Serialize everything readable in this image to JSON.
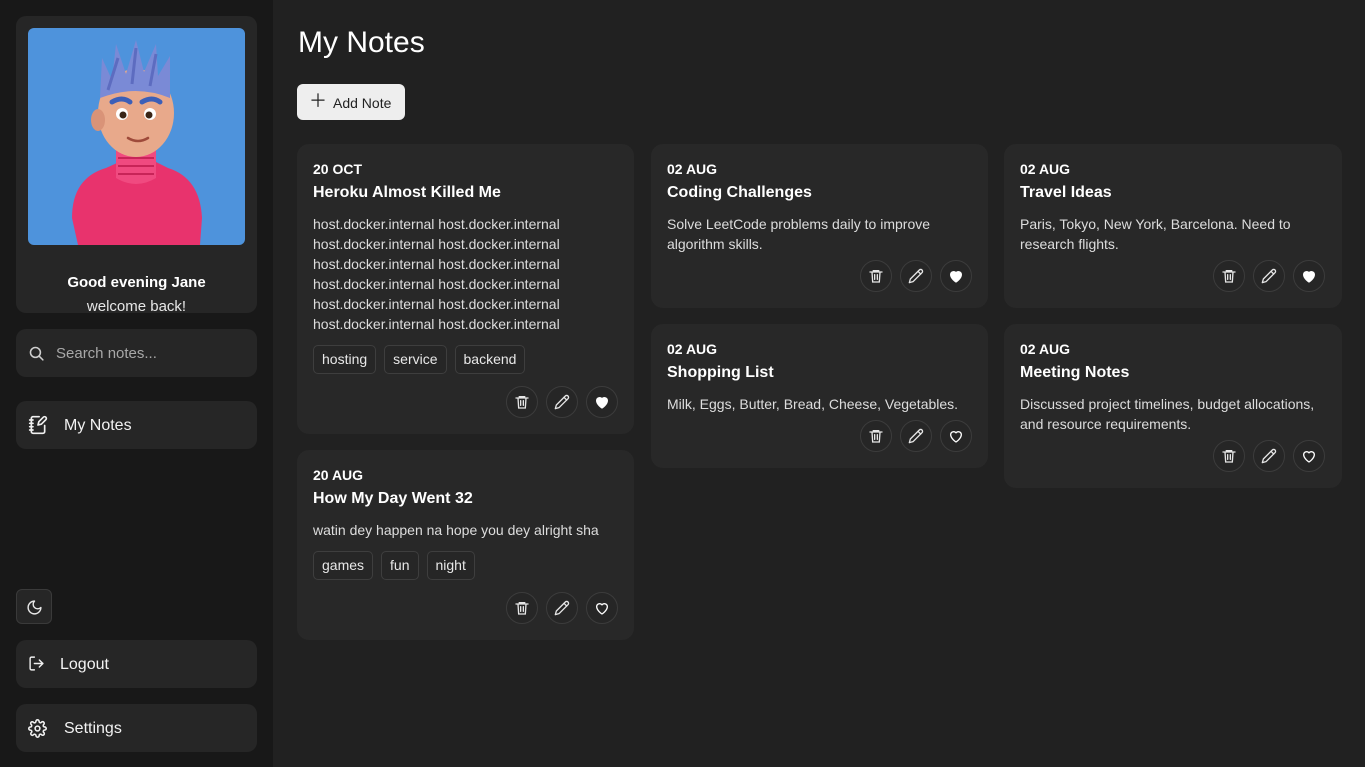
{
  "profile": {
    "greeting": "Good evening Jane",
    "welcome": "welcome back!",
    "avatar_bg": "#4e93dc"
  },
  "search": {
    "placeholder": "Search notes..."
  },
  "nav": {
    "my_notes": "My Notes",
    "logout": "Logout",
    "settings": "Settings"
  },
  "main": {
    "title": "My Notes",
    "add_note_label": "Add Note"
  },
  "notes": [
    {
      "date": "20 OCT",
      "title": "Heroku Almost Killed Me",
      "body": "host.docker.internal host.docker.internal host.docker.internal host.docker.internal host.docker.internal host.docker.internal host.docker.internal host.docker.internal host.docker.internal host.docker.internal host.docker.internal host.docker.internal",
      "tags": [
        "hosting",
        "service",
        "backend"
      ],
      "favorite": true
    },
    {
      "date": "20 AUG",
      "title": "How My Day Went 32",
      "body": "watin dey happen na hope you dey alright sha",
      "tags": [
        "games",
        "fun",
        "night"
      ],
      "favorite": false
    },
    {
      "date": "02 AUG",
      "title": "Coding Challenges",
      "body": "Solve LeetCode problems daily to improve algorithm skills.",
      "tags": [],
      "favorite": true
    },
    {
      "date": "02 AUG",
      "title": "Shopping List",
      "body": "Milk, Eggs, Butter, Bread, Cheese, Vegetables.",
      "tags": [],
      "favorite": false
    },
    {
      "date": "02 AUG",
      "title": "Travel Ideas",
      "body": "Paris, Tokyo, New York, Barcelona. Need to research flights.",
      "tags": [],
      "favorite": true
    },
    {
      "date": "02 AUG",
      "title": "Meeting Notes",
      "body": "Discussed project timelines, budget allocations, and resource requirements.",
      "tags": [],
      "favorite": false
    }
  ],
  "icons": {
    "search": "search-icon",
    "notes": "notebook-pen-icon",
    "theme": "moon-icon",
    "logout": "logout-icon",
    "settings": "gear-icon",
    "delete": "trash-icon",
    "edit": "pencil-icon",
    "favorite": "heart-icon"
  }
}
